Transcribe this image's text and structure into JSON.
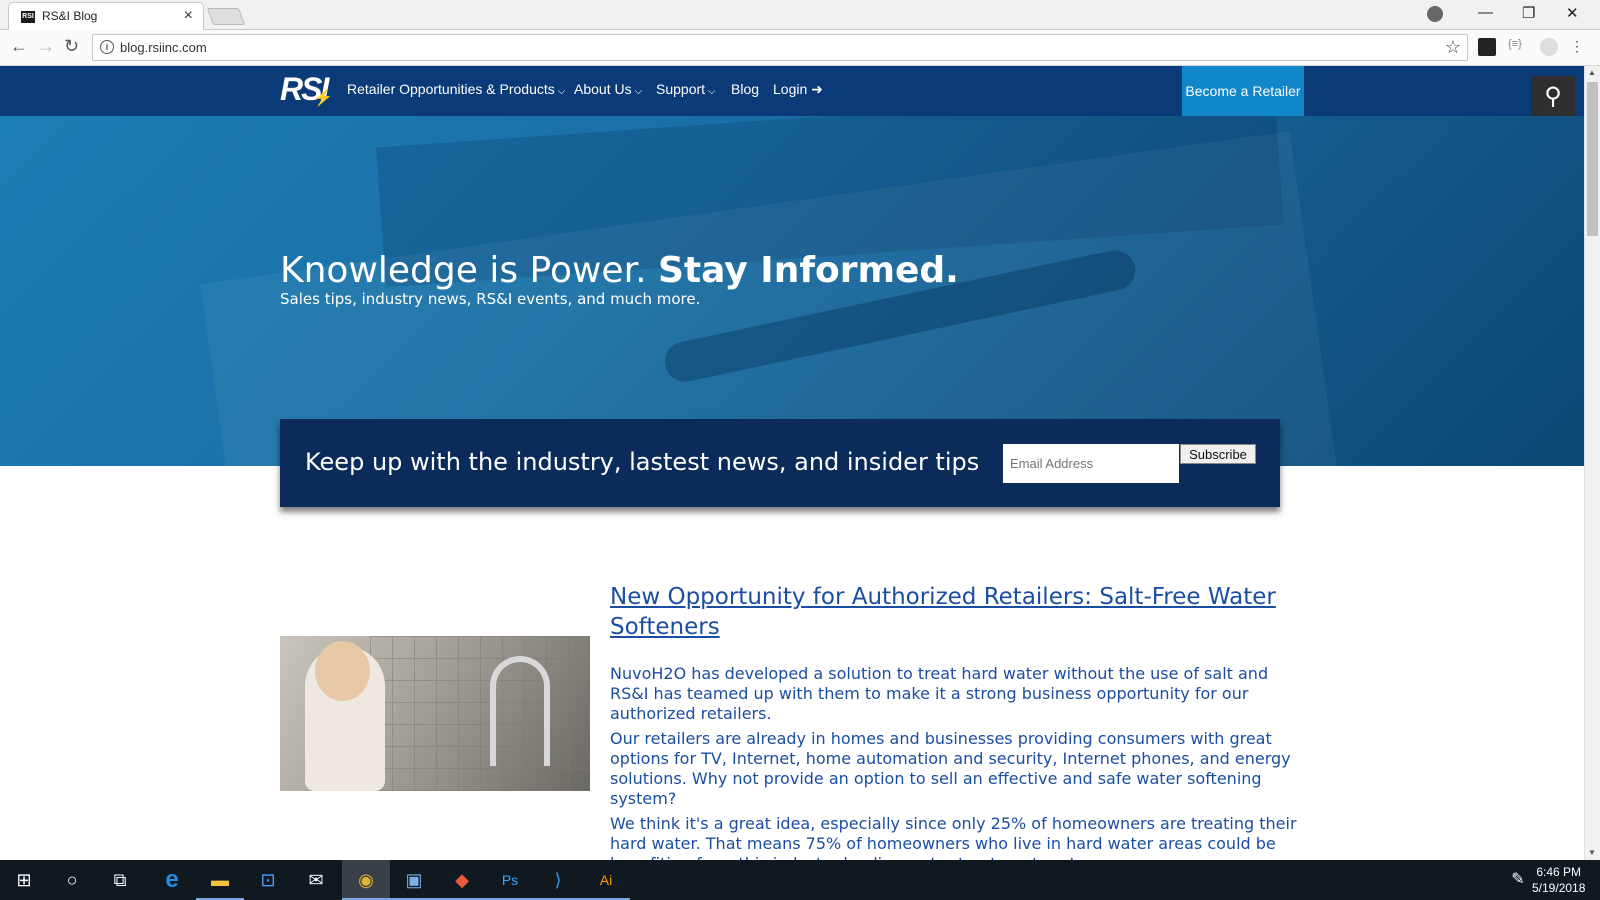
{
  "browser": {
    "tab_title": "RS&I Blog",
    "tab_close": "×",
    "url": "blog.rsiinc.com",
    "win_minimize": "—",
    "win_restore": "❐",
    "win_close": "✕",
    "back": "←",
    "forward": "→",
    "reload": "↻",
    "star": "☆"
  },
  "site": {
    "logo_text": "RSI",
    "nav": [
      {
        "label": "Retailer Opportunities & Products"
      },
      {
        "label": "About Us"
      },
      {
        "label": "Support"
      },
      {
        "label": "Blog"
      },
      {
        "label": "Login"
      }
    ],
    "become_retailer": "Become a Retailer",
    "hero": {
      "title_light": "Knowledge is Power.",
      "title_bold": "Stay Informed.",
      "subtitle": "Sales tips, industry news, RS&I events, and much more."
    },
    "subscribe": {
      "text": "Keep up with the industry, lastest news, and insider tips",
      "email_placeholder": "Email Address",
      "button": "Subscribe"
    },
    "article": {
      "title": "New Opportunity for Authorized Retailers: Salt-Free Water Softeners",
      "paragraphs": [
        "NuvoH2O has developed a solution to treat hard water without the use of salt and RS&I has teamed up with them to make it a strong business opportunity for our authorized retailers.",
        "Our retailers are already in homes and businesses providing consumers with great options for TV, Internet, home automation and security, Internet phones, and energy solutions. Why not provide an option to sell an effective and safe water softening system?",
        "We think it's a great idea, especially since only 25% of homeowners are treating their hard water. That means 75% of homeowners who live in hard water areas could be benefiting from this industry leading water treatment system."
      ]
    }
  },
  "taskbar": {
    "icons": [
      "windows-start-icon",
      "cortana-icon",
      "task-view-icon",
      "edge-icon",
      "file-explorer-icon",
      "store-icon",
      "mail-icon",
      "chrome-icon",
      "app-icon",
      "git-icon",
      "photoshop-icon",
      "vscode-icon",
      "illustrator-icon"
    ],
    "time": "6:46 PM",
    "date": "5/19/2018",
    "ps_label": "Ps",
    "ai_label": "Ai"
  },
  "colors": {
    "nav_bg": "#0b3a78",
    "accent": "#1186c8",
    "subscribe_bg": "#0b2b5a",
    "link": "#1b4ea3"
  }
}
